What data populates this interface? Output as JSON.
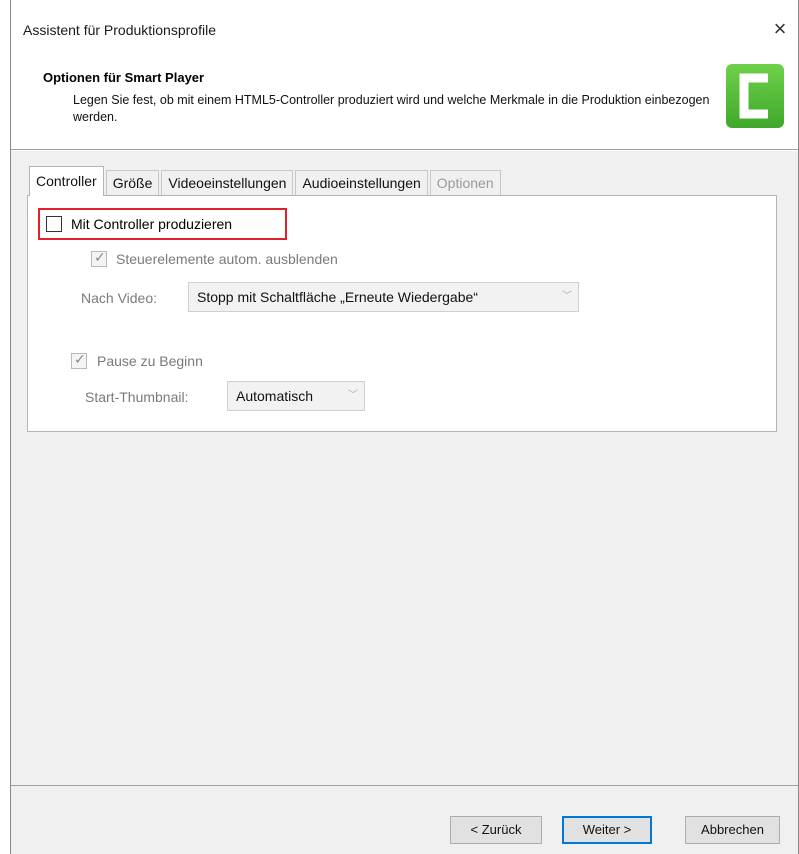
{
  "window": {
    "title": "Assistent für Produktionsprofile",
    "close_glyph": "×"
  },
  "header": {
    "title": "Optionen für Smart Player",
    "description": "Legen Sie fest, ob mit einem HTML5-Controller produziert wird und welche Merkmale in die Produktion einbezogen werden.",
    "logo_icon": "camtasia-logo-icon",
    "logo_color": "#4cb82f"
  },
  "tabs": [
    {
      "label": "Controller",
      "state": "active"
    },
    {
      "label": "Größe",
      "state": "normal"
    },
    {
      "label": "Videoeinstellungen",
      "state": "normal"
    },
    {
      "label": "Audioeinstellungen",
      "state": "normal"
    },
    {
      "label": "Optionen",
      "state": "disabled"
    }
  ],
  "controller": {
    "produce_with_controller": {
      "label": "Mit Controller produzieren",
      "checked": false
    },
    "autohide_controls": {
      "label": "Steuerelemente autom. ausblenden",
      "checked": true,
      "enabled": false
    },
    "after_video": {
      "label": "Nach Video:",
      "value": "Stopp mit Schaltfläche „Erneute Wiedergabe“"
    },
    "pause_at_start": {
      "label": "Pause zu Beginn",
      "checked": true,
      "enabled": false
    },
    "start_thumbnail": {
      "label": "Start-Thumbnail:",
      "value": "Automatisch"
    },
    "highlight_color": "#e0202a"
  },
  "footer": {
    "back_label": "< Zurück",
    "next_label": "Weiter >",
    "cancel_label": "Abbrechen",
    "accent_color": "#0078d7"
  }
}
